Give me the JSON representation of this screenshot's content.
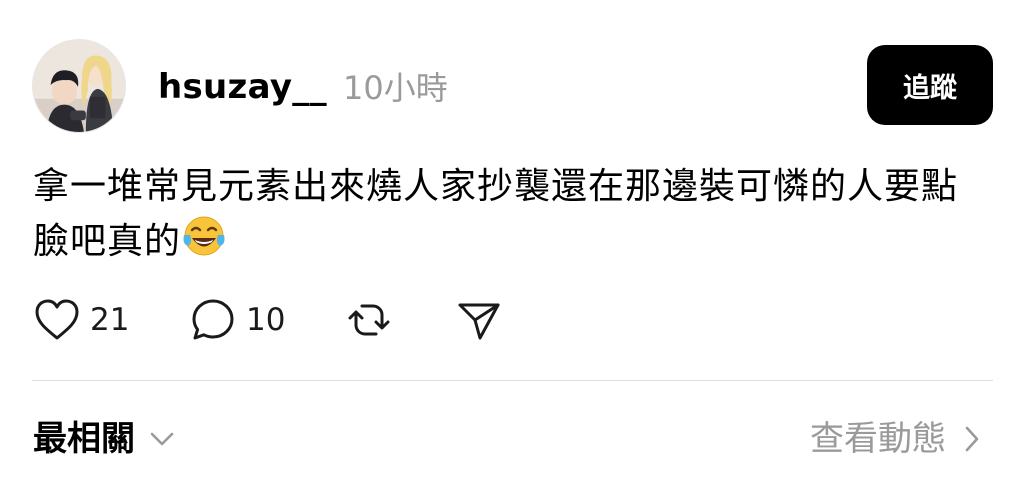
{
  "post": {
    "username": "hsuzay__",
    "time": "10小時",
    "follow_label": "追蹤",
    "text": "拿一堆常見元素出來燒人家抄襲還在那邊裝可憐的人要點臉吧真的",
    "emoji": "face-with-tears-of-joy"
  },
  "actions": {
    "likes": "21",
    "comments": "10"
  },
  "replies_header": {
    "sort_label": "最相關",
    "view_activity": "查看動態"
  },
  "icons": {
    "like": "heart-icon",
    "comment": "comment-bubble-icon",
    "repost": "repost-icon",
    "share": "send-icon"
  }
}
